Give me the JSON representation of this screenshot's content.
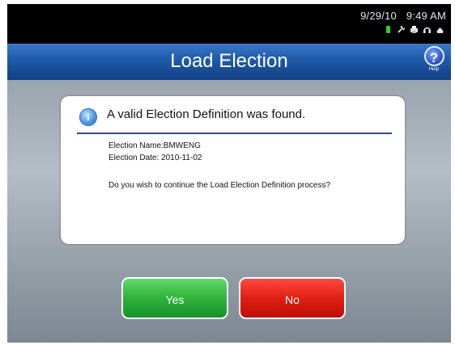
{
  "status": {
    "date": "9/29/10",
    "time": "9:49 AM",
    "icons": [
      "battery-icon",
      "power-plug-icon",
      "printer-icon",
      "headphones-icon",
      "network-icon"
    ]
  },
  "header": {
    "title": "Load Election",
    "help_label": "Help",
    "help_symbol": "?"
  },
  "dialog": {
    "info_symbol": "i",
    "message": "A valid Election Definition was found.",
    "election_name": "Election Name:BMWENG",
    "election_date": "Election Date: 2010-11-02",
    "question": "Do you wish to continue the Load Election Definition process?"
  },
  "buttons": {
    "yes_label": "Yes",
    "no_label": "No"
  },
  "colors": {
    "title_bar": "#1f5aa9",
    "yes_button": "#2fb43a",
    "no_button": "#e01f14"
  }
}
